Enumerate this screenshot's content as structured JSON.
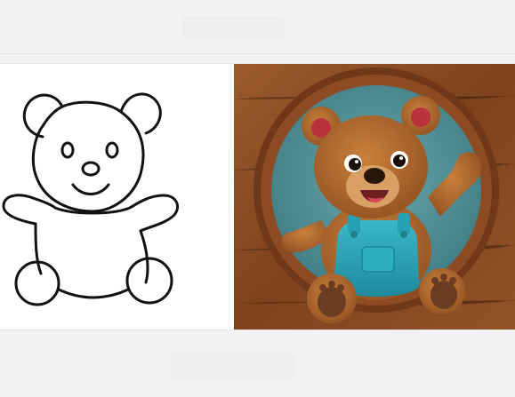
{
  "page": {
    "background_color": "#f3f3f4",
    "card_color": "#ffffff"
  },
  "left_image": {
    "kind": "line-art teddy bear outline",
    "stroke_color": "#111111"
  },
  "right_image": {
    "kind": "colored 3D teddy bear in blue overalls waving",
    "fur_color": "#a8612a",
    "overalls_color": "#29a3b5",
    "circle_backdrop_color": "#4e8f96",
    "wood_color": "#8a4a22"
  }
}
